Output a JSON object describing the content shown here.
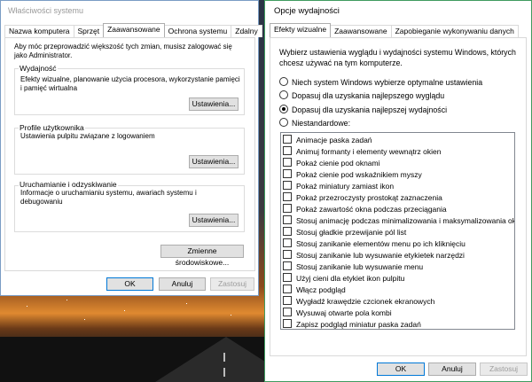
{
  "system_properties": {
    "title": "Właściwości systemu",
    "tabs": [
      {
        "label": "Nazwa komputera"
      },
      {
        "label": "Sprzęt"
      },
      {
        "label": "Zaawansowane"
      },
      {
        "label": "Ochrona systemu"
      },
      {
        "label": "Zdalny"
      }
    ],
    "active_tab": "Zaawansowane",
    "intro": "Aby móc przeprowadzić większość tych zmian, musisz zalogować się jako Administrator.",
    "performance": {
      "title": "Wydajność",
      "text": "Efekty wizualne, planowanie użycia procesora, wykorzystanie pamięci i pamięć wirtualna",
      "button": "Ustawienia..."
    },
    "user_profiles": {
      "title": "Profile użytkownika",
      "text": "Ustawienia pulpitu związane z logowaniem",
      "button": "Ustawienia..."
    },
    "startup_recovery": {
      "title": "Uruchamianie i odzyskiwanie",
      "text": "Informacje o uruchamianiu systemu, awariach systemu i debugowaniu",
      "button": "Ustawienia..."
    },
    "env_button": "Zmienne środowiskowe...",
    "ok": "OK",
    "cancel": "Anuluj",
    "apply": "Zastosuj"
  },
  "performance_options": {
    "title": "Opcje wydajności",
    "tabs": [
      {
        "label": "Efekty wizualne"
      },
      {
        "label": "Zaawansowane"
      },
      {
        "label": "Zapobieganie wykonywaniu danych"
      }
    ],
    "active_tab": "Efekty wizualne",
    "description": "Wybierz ustawienia wyglądu i wydajności systemu Windows, których chcesz używać na tym komputerze.",
    "radios": [
      {
        "label": "Niech system Windows wybierze optymalne ustawienia",
        "selected": false
      },
      {
        "label": "Dopasuj dla uzyskania najlepszego wyglądu",
        "selected": false
      },
      {
        "label": "Dopasuj dla uzyskania najlepszej wydajności",
        "selected": true
      },
      {
        "label": "Niestandardowe:",
        "selected": false
      }
    ],
    "effects": [
      {
        "label": "Animacje paska zadań",
        "checked": false
      },
      {
        "label": "Animuj formanty i elementy wewnątrz okien",
        "checked": false
      },
      {
        "label": "Pokaż cienie pod oknami",
        "checked": false
      },
      {
        "label": "Pokaż cienie pod wskaźnikiem myszy",
        "checked": false
      },
      {
        "label": "Pokaż miniatury zamiast ikon",
        "checked": false
      },
      {
        "label": "Pokaż przezroczysty prostokąt zaznaczenia",
        "checked": false
      },
      {
        "label": "Pokaż zawartość okna podczas przeciągania",
        "checked": false
      },
      {
        "label": "Stosuj animację podczas minimalizowania i maksymalizowania ok",
        "checked": false
      },
      {
        "label": "Stosuj gładkie przewijanie pól list",
        "checked": false
      },
      {
        "label": "Stosuj zanikanie elementów menu po ich kliknięciu",
        "checked": false
      },
      {
        "label": "Stosuj zanikanie lub wysuwanie etykietek narzędzi",
        "checked": false
      },
      {
        "label": "Stosuj zanikanie lub wysuwanie menu",
        "checked": false
      },
      {
        "label": "Użyj cieni dla etykiet ikon pulpitu",
        "checked": false
      },
      {
        "label": "Włącz podgląd",
        "checked": false
      },
      {
        "label": "Wygładź krawędzie czcionek ekranowych",
        "checked": false
      },
      {
        "label": "Wysuwaj otwarte pola kombi",
        "checked": false
      },
      {
        "label": "Zapisz podgląd miniatur paska zadań",
        "checked": false
      }
    ],
    "ok": "OK",
    "cancel": "Anuluj",
    "apply": "Zastosuj"
  }
}
